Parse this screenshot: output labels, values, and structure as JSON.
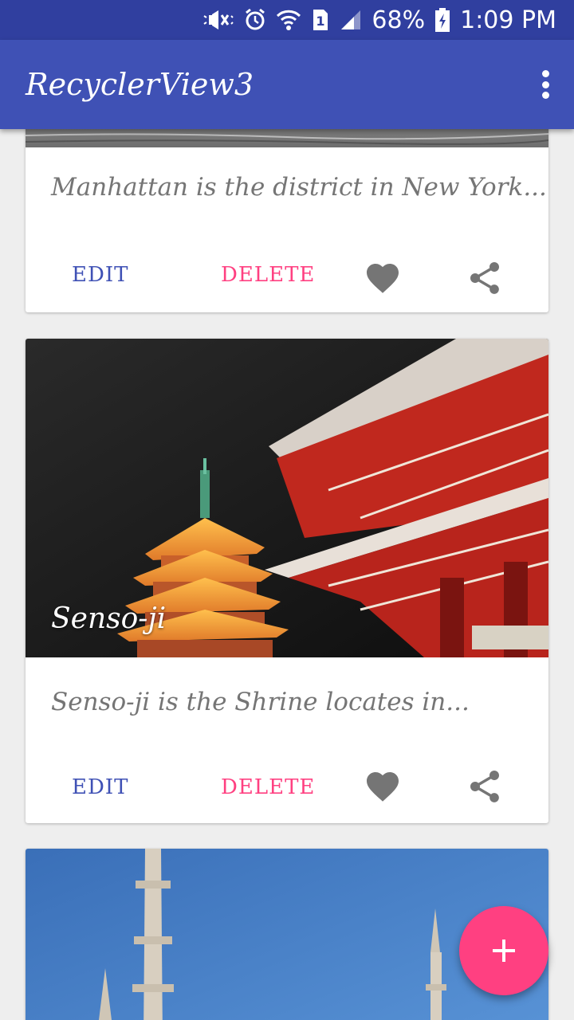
{
  "status_bar": {
    "battery": "68%",
    "time": "1:09 PM",
    "sim_badge": "1"
  },
  "toolbar": {
    "title": "RecyclerView3"
  },
  "cards": [
    {
      "description": "Manhattan is the district in New York...",
      "edit_label": "EDIT",
      "delete_label": "DELETE"
    },
    {
      "caption": "Senso-ji",
      "description": "Senso-ji is the Shrine locates in...",
      "edit_label": "EDIT",
      "delete_label": "DELETE"
    }
  ],
  "colors": {
    "primary": "#3f51b5",
    "primary_dark": "#303f9f",
    "accent": "#ff4081",
    "icon_gray": "#757575"
  },
  "icons": [
    "mute-icon",
    "alarm-icon",
    "wifi-icon",
    "signal-icon",
    "battery-icon",
    "overflow-menu-icon",
    "heart-icon",
    "share-icon",
    "add-icon"
  ]
}
